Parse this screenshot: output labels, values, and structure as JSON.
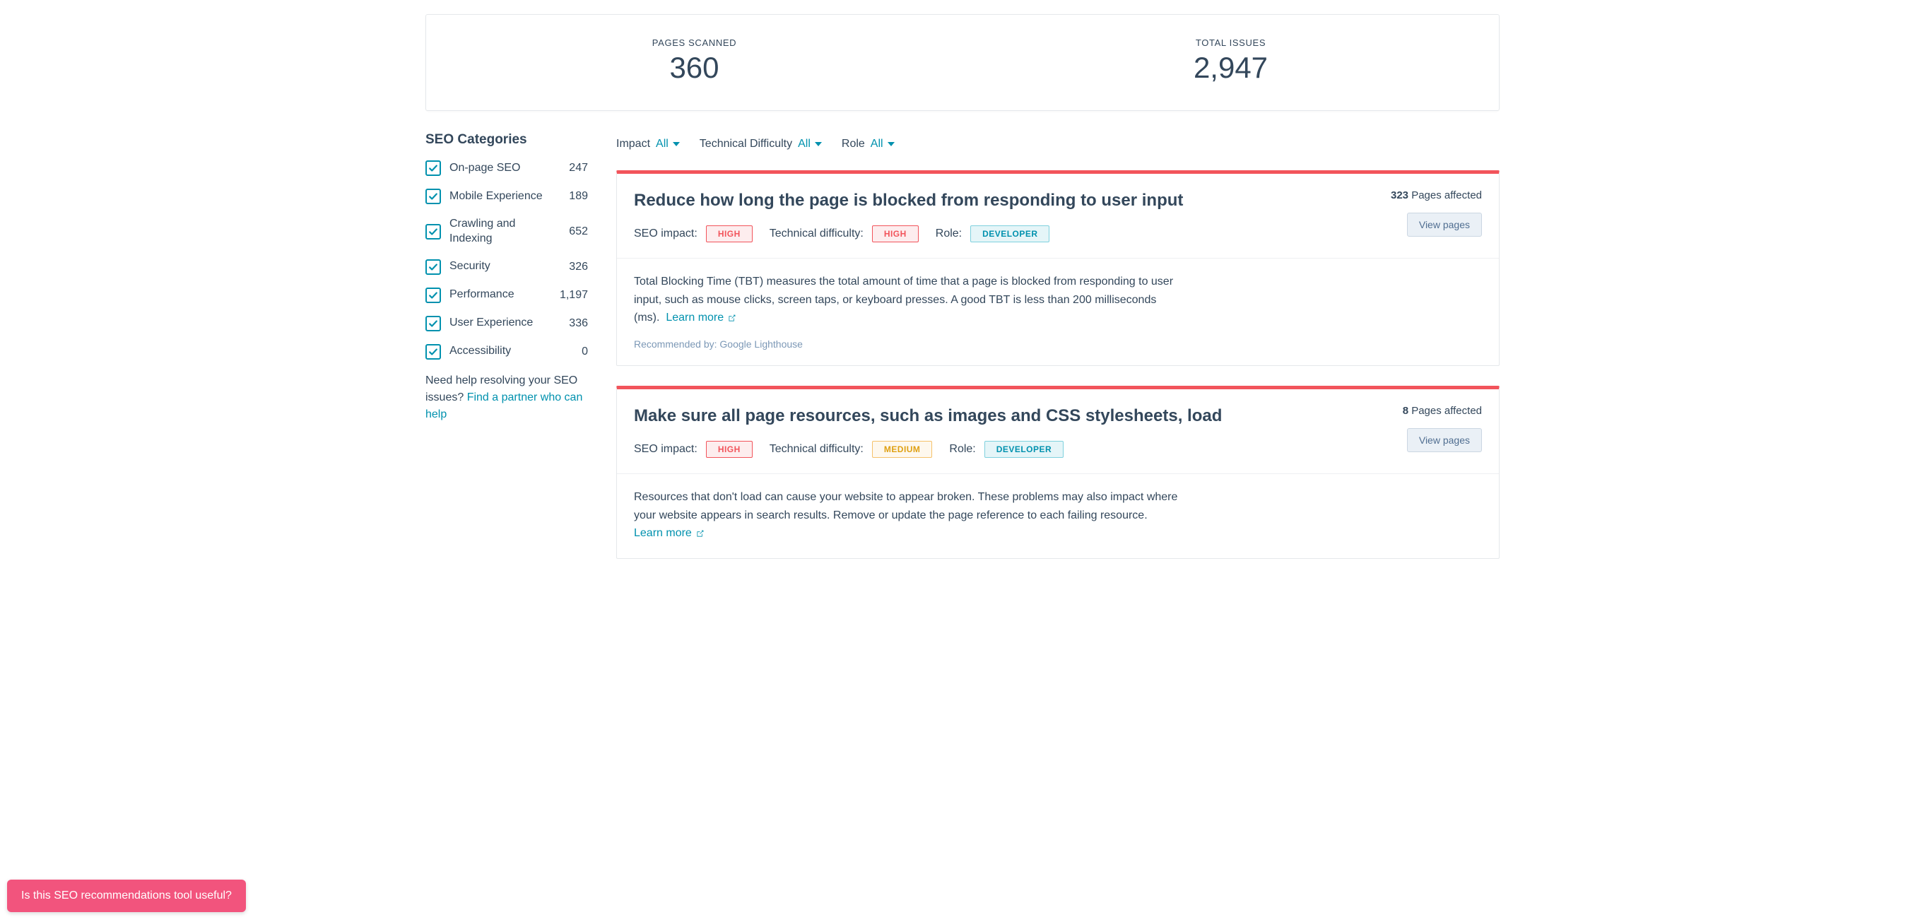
{
  "stats": {
    "pages_scanned_label": "PAGES SCANNED",
    "pages_scanned_value": "360",
    "total_issues_label": "TOTAL ISSUES",
    "total_issues_value": "2,947"
  },
  "sidebar": {
    "heading": "SEO Categories",
    "categories": [
      {
        "label": "On-page SEO",
        "count": "247"
      },
      {
        "label": "Mobile Experience",
        "count": "189"
      },
      {
        "label": "Crawling and Indexing",
        "count": "652"
      },
      {
        "label": "Security",
        "count": "326"
      },
      {
        "label": "Performance",
        "count": "1,197"
      },
      {
        "label": "User Experience",
        "count": "336"
      },
      {
        "label": "Accessibility",
        "count": "0"
      }
    ],
    "help_prefix": "Need help resolving your SEO issues? ",
    "help_link": "Find a partner who can help"
  },
  "filters": {
    "impact_label": "Impact",
    "impact_value": "All",
    "difficulty_label": "Technical Difficulty",
    "difficulty_value": "All",
    "role_label": "Role",
    "role_value": "All"
  },
  "labels": {
    "seo_impact": "SEO impact:",
    "tech_difficulty": "Technical difficulty:",
    "role": "Role:",
    "pages_affected_suffix": " Pages affected",
    "view_pages": "View pages",
    "learn_more": "Learn more",
    "recommended_by_prefix": "Recommended by: "
  },
  "recommendations": [
    {
      "title": "Reduce how long the page is blocked from responding to user input",
      "seo_impact": "HIGH",
      "tech_difficulty": "HIGH",
      "role": "DEVELOPER",
      "affected_count": "323",
      "description": "Total Blocking Time (TBT) measures the total amount of time that a page is blocked from responding to user input, such as mouse clicks, screen taps, or keyboard presses. A good TBT is less than 200 milliseconds (ms).",
      "recommended_by": "Google Lighthouse"
    },
    {
      "title": "Make sure all page resources, such as images and CSS stylesheets, load",
      "seo_impact": "HIGH",
      "tech_difficulty": "MEDIUM",
      "role": "DEVELOPER",
      "affected_count": "8",
      "description": "Resources that don't load can cause your website to appear broken. These problems may also impact where your website appears in search results. Remove or update the page reference to each failing resource.",
      "recommended_by": ""
    }
  ],
  "feedback": {
    "text": "Is this SEO recommendations tool useful?"
  }
}
